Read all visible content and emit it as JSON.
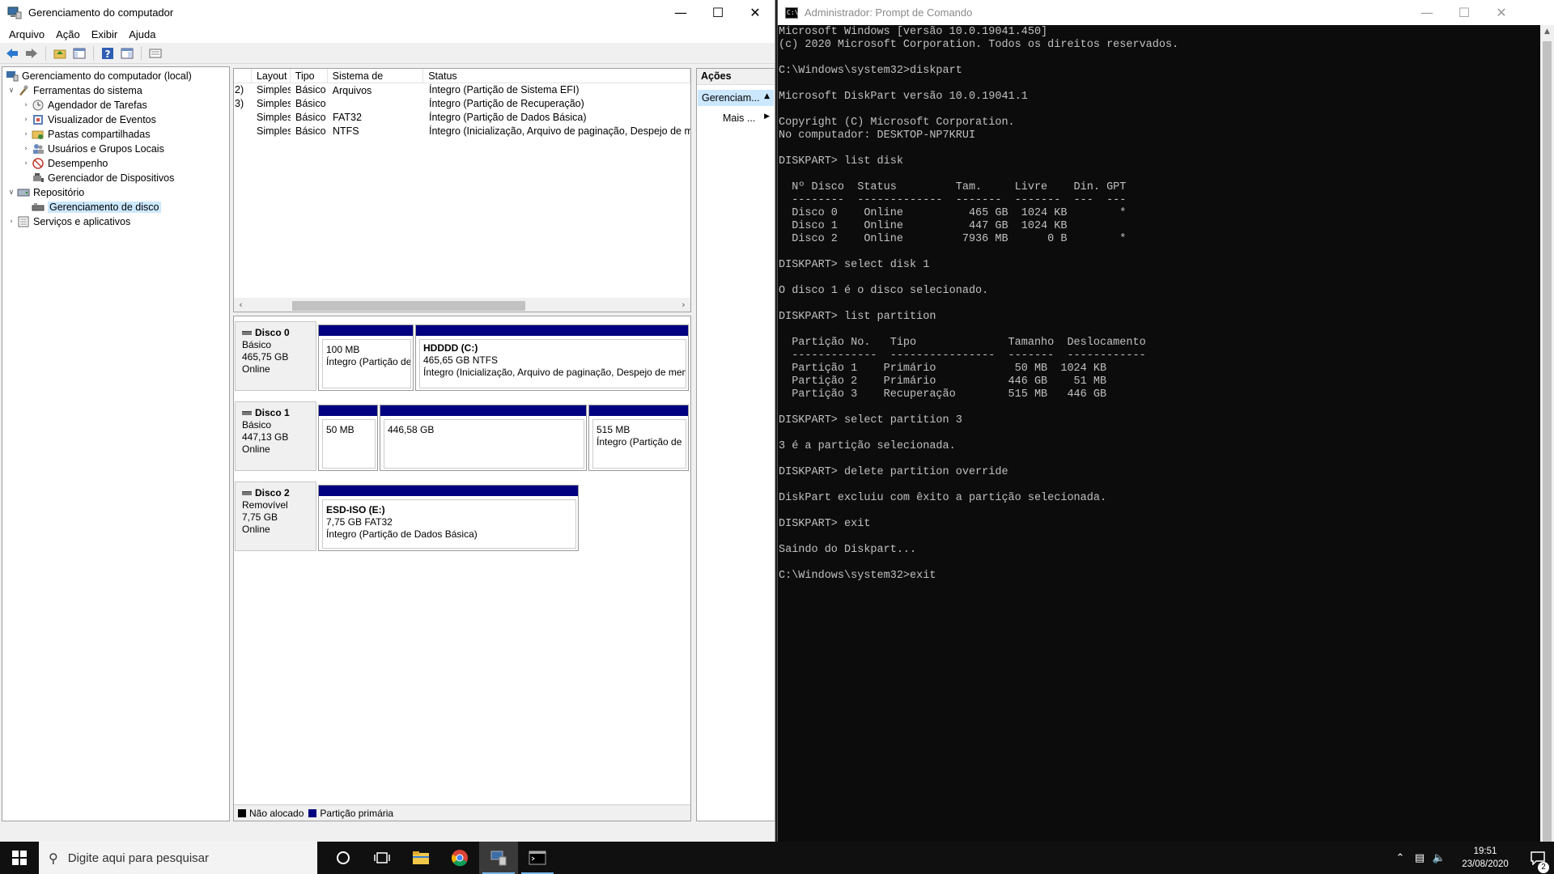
{
  "mmc": {
    "title": "Gerenciamento do computador",
    "menu": [
      "Arquivo",
      "Ação",
      "Exibir",
      "Ajuda"
    ],
    "tree": {
      "root": "Gerenciamento do computador (local)",
      "system_tools": "Ferramentas do sistema",
      "task_scheduler": "Agendador de Tarefas",
      "event_viewer": "Visualizador de Eventos",
      "shared_folders": "Pastas compartilhadas",
      "local_users": "Usuários e Grupos Locais",
      "performance": "Desempenho",
      "device_manager": "Gerenciador de Dispositivos",
      "storage": "Repositório",
      "disk_management": "Gerenciamento de disco",
      "services": "Serviços e aplicativos"
    },
    "volume_list": {
      "columns": [
        "Layout",
        "Tipo",
        "Sistema de Arquivos",
        "Status"
      ],
      "rows": [
        {
          "prefix": "2)",
          "layout": "Simples",
          "type": "Básico",
          "fs": "",
          "status": "Íntegro (Partição de Sistema EFI)"
        },
        {
          "prefix": "3)",
          "layout": "Simples",
          "type": "Básico",
          "fs": "",
          "status": "Íntegro (Partição de Recuperação)"
        },
        {
          "prefix": "",
          "layout": "Simples",
          "type": "Básico",
          "fs": "FAT32",
          "status": "Íntegro (Partição de Dados Básica)"
        },
        {
          "prefix": "",
          "layout": "Simples",
          "type": "Básico",
          "fs": "NTFS",
          "status": "Íntegro (Inicialização, Arquivo de paginação, Despejo de mem"
        }
      ]
    },
    "disks": [
      {
        "name": "Disco 0",
        "kind": "Básico",
        "size": "465,75 GB",
        "state": "Online",
        "parts": [
          {
            "name": "",
            "size": "100 MB",
            "status": "Íntegro (Partição de"
          },
          {
            "name": "HDDDD  (C:)",
            "size": "465,65 GB NTFS",
            "status": "Íntegro (Inicialização, Arquivo de paginação, Despejo de mem"
          }
        ]
      },
      {
        "name": "Disco 1",
        "kind": "Básico",
        "size": "447,13 GB",
        "state": "Online",
        "parts": [
          {
            "name": "",
            "size": "50 MB",
            "status": ""
          },
          {
            "name": "",
            "size": "446,58 GB",
            "status": ""
          },
          {
            "name": "",
            "size": "515 MB",
            "status": "Íntegro (Partição de"
          }
        ]
      },
      {
        "name": "Disco 2",
        "kind": "Removível",
        "size": "7,75 GB",
        "state": "Online",
        "parts": [
          {
            "name": "ESD-ISO  (E:)",
            "size": "7,75 GB FAT32",
            "status": "Íntegro (Partição de Dados Básica)"
          }
        ]
      }
    ],
    "legend": {
      "unallocated": "Não alocado",
      "primary": "Partição primária"
    },
    "actions": {
      "header": "Ações",
      "selected": "Gerenciam...",
      "more": "Mais ..."
    }
  },
  "cmd": {
    "title": "Administrador: Prompt de Comando",
    "lines": [
      "Microsoft Windows [versão 10.0.19041.450]",
      "(c) 2020 Microsoft Corporation. Todos os direitos reservados.",
      "",
      "C:\\Windows\\system32>diskpart",
      "",
      "Microsoft DiskPart versão 10.0.19041.1",
      "",
      "Copyright (C) Microsoft Corporation.",
      "No computador: DESKTOP-NP7KRUI",
      "",
      "DISKPART> list disk",
      "",
      "  Nº Disco  Status         Tam.     Livre    Din. GPT",
      "  --------  -------------  -------  -------  ---  ---",
      "  Disco 0    Online          465 GB  1024 KB        *",
      "  Disco 1    Online          447 GB  1024 KB",
      "  Disco 2    Online         7936 MB      0 B        *",
      "",
      "DISKPART> select disk 1",
      "",
      "O disco 1 é o disco selecionado.",
      "",
      "DISKPART> list partition",
      "",
      "  Partição No.   Tipo              Tamanho  Deslocamento",
      "  -------------  ----------------  -------  ------------",
      "  Partição 1    Primário            50 MB  1024 KB",
      "  Partição 2    Primário           446 GB    51 MB",
      "  Partição 3    Recuperação        515 MB   446 GB",
      "",
      "DISKPART> select partition 3",
      "",
      "3 é a partição selecionada.",
      "",
      "DISKPART> delete partition override",
      "",
      "DiskPart excluiu com êxito a partição selecionada.",
      "",
      "DISKPART> exit",
      "",
      "Saindo do Diskpart...",
      "",
      "C:\\Windows\\system32>exit"
    ]
  },
  "taskbar": {
    "search_placeholder": "Digite aqui para pesquisar",
    "time": "19:51",
    "date": "23/08/2020",
    "notifications": "2"
  },
  "colors": {
    "primary_partition": "#000080",
    "unallocated": "#000000",
    "selection": "#cce8ff",
    "console_bg": "#0c0c0c",
    "console_fg": "#c0c0c0"
  }
}
